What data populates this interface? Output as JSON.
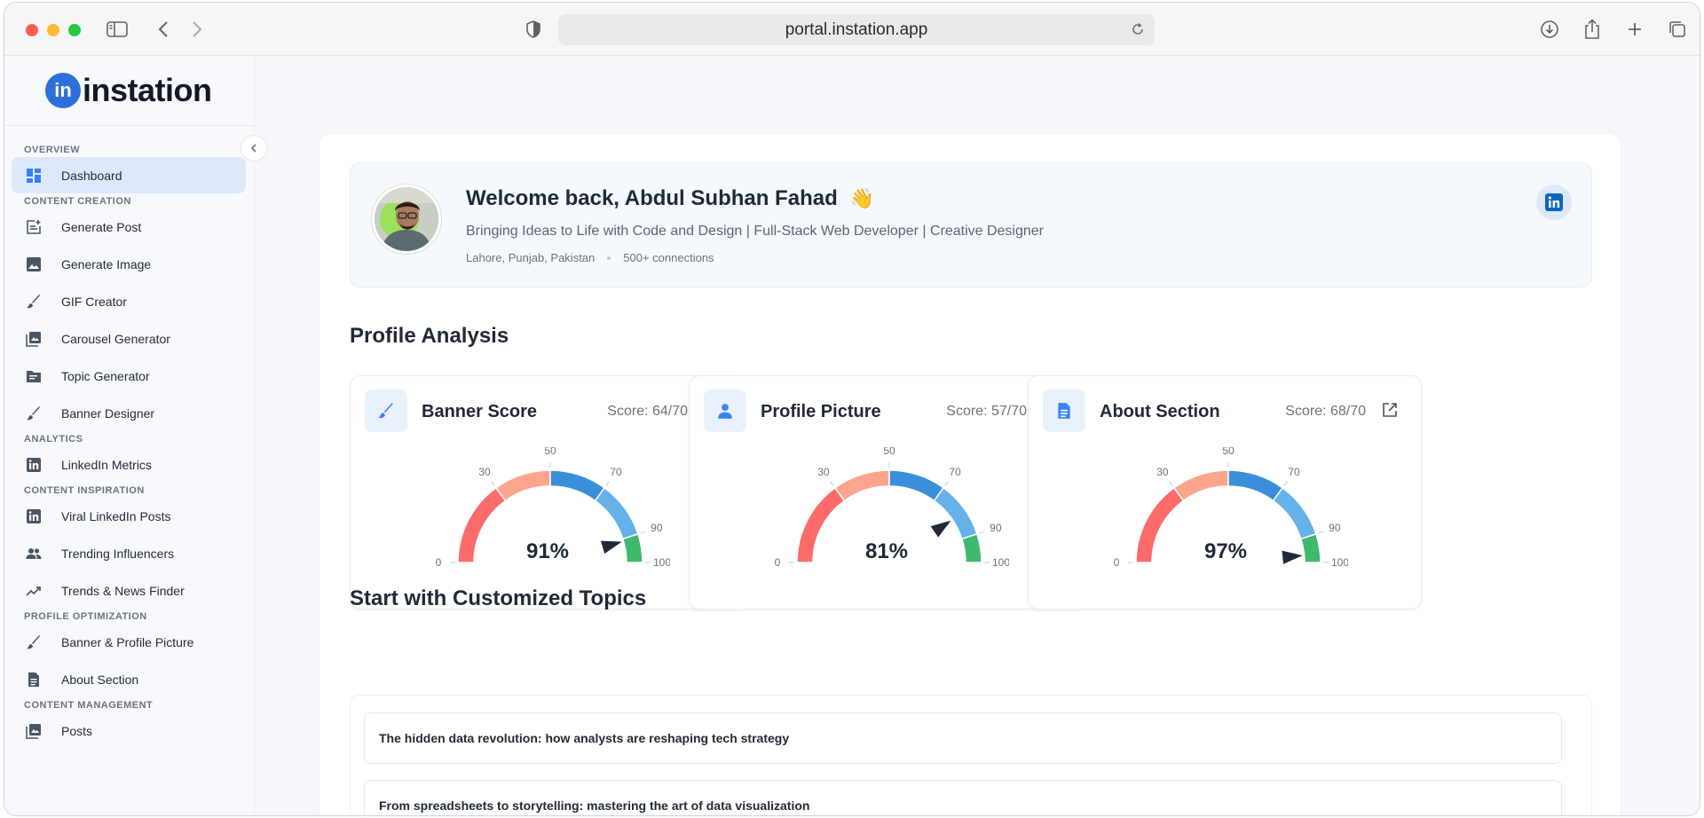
{
  "browser": {
    "url": "portal.instation.app"
  },
  "brand": {
    "logo_mark": "in",
    "name": "instation",
    "accent": "#2f6fdc"
  },
  "sidebar": {
    "sections": [
      {
        "title": "OVERVIEW",
        "items": [
          {
            "label": "Dashboard",
            "icon": "dashboard-icon",
            "active": true
          }
        ]
      },
      {
        "title": "CONTENT CREATION",
        "items": [
          {
            "label": "Generate Post",
            "icon": "post-add-icon"
          },
          {
            "label": "Generate Image",
            "icon": "image-icon"
          },
          {
            "label": "GIF Creator",
            "icon": "brush-icon"
          },
          {
            "label": "Carousel Generator",
            "icon": "collections-icon"
          },
          {
            "label": "Topic Generator",
            "icon": "folder-icon"
          },
          {
            "label": "Banner Designer",
            "icon": "brush-icon"
          }
        ]
      },
      {
        "title": "ANALYTICS",
        "items": [
          {
            "label": "LinkedIn Metrics",
            "icon": "linkedin-icon"
          }
        ]
      },
      {
        "title": "CONTENT INSPIRATION",
        "items": [
          {
            "label": "Viral LinkedIn Posts",
            "icon": "linkedin-icon"
          },
          {
            "label": "Trending Influencers",
            "icon": "people-icon"
          },
          {
            "label": "Trends & News Finder",
            "icon": "trending-icon"
          }
        ]
      },
      {
        "title": "PROFILE OPTIMIZATION",
        "items": [
          {
            "label": "Banner & Profile Picture",
            "icon": "brush-icon"
          },
          {
            "label": "About Section",
            "icon": "document-icon"
          }
        ]
      },
      {
        "title": "CONTENT MANAGEMENT",
        "items": [
          {
            "label": "Posts",
            "icon": "collections-icon"
          }
        ]
      }
    ]
  },
  "profile": {
    "welcome": "Welcome back, Abdul Subhan Fahad",
    "wave": "👋",
    "headline": "Bringing Ideas to Life with Code and Design | Full-Stack Web Developer | Creative Designer",
    "location": "Lahore, Punjab, Pakistan",
    "connections": "500+ connections"
  },
  "analysis": {
    "title": "Profile Analysis",
    "gauge_ticks": [
      "0",
      "30",
      "50",
      "70",
      "90",
      "100"
    ],
    "cards": [
      {
        "title": "Banner Score",
        "score": "Score: 64/70",
        "percent": "91%",
        "value": 91,
        "icon": "brush-icon"
      },
      {
        "title": "Profile Picture",
        "score": "Score: 57/70",
        "percent": "81%",
        "value": 81,
        "icon": "person-icon"
      },
      {
        "title": "About Section",
        "score": "Score: 68/70",
        "percent": "97%",
        "value": 97,
        "icon": "document-icon"
      }
    ],
    "colors": {
      "red": "#fd6b6b",
      "salmon": "#fda58c",
      "blue": "#3b8fda",
      "lightblue": "#65b1ea",
      "green": "#3fba6c",
      "needle": "#1f2937"
    }
  },
  "topics": {
    "title": "Start with Customized Topics",
    "items": [
      "The hidden data revolution: how analysts are reshaping tech strategy",
      "From spreadsheets to storytelling: mastering the art of data visualization"
    ]
  }
}
